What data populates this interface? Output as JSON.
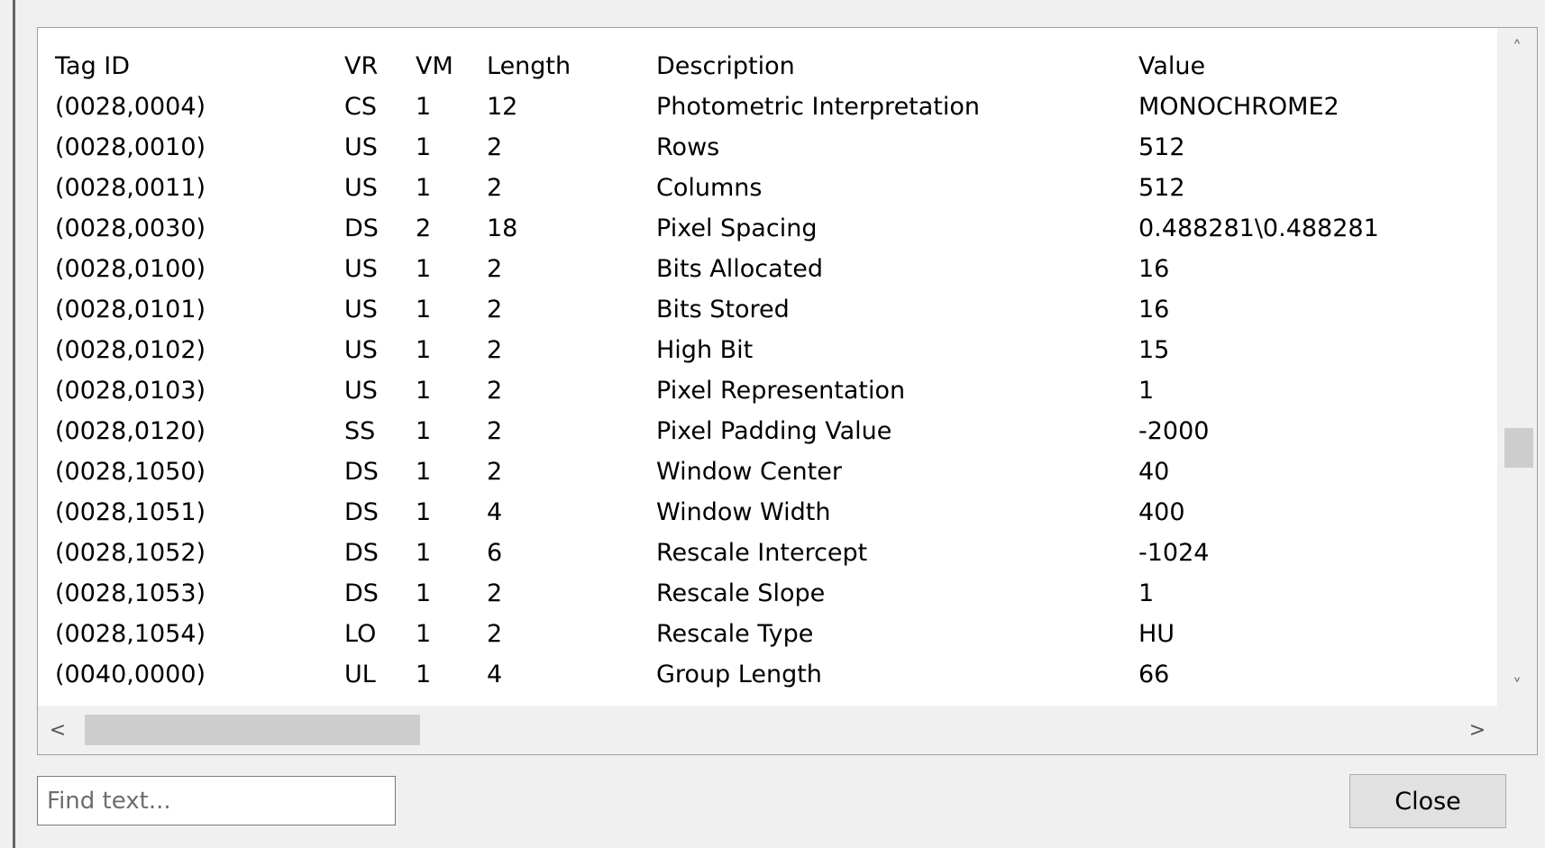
{
  "table": {
    "columns": [
      "Tag ID",
      "VR",
      "VM",
      "Length",
      "Description",
      "Value"
    ],
    "rows": [
      [
        "(0028,0004)",
        "CS",
        "1",
        "12",
        "Photometric Interpretation",
        "MONOCHROME2"
      ],
      [
        "(0028,0010)",
        "US",
        "1",
        "2",
        "Rows",
        "512"
      ],
      [
        "(0028,0011)",
        "US",
        "1",
        "2",
        "Columns",
        "512"
      ],
      [
        "(0028,0030)",
        "DS",
        "2",
        "18",
        "Pixel Spacing",
        "0.488281\\0.488281"
      ],
      [
        "(0028,0100)",
        "US",
        "1",
        "2",
        "Bits Allocated",
        "16"
      ],
      [
        "(0028,0101)",
        "US",
        "1",
        "2",
        "Bits Stored",
        "16"
      ],
      [
        "(0028,0102)",
        "US",
        "1",
        "2",
        "High Bit",
        "15"
      ],
      [
        "(0028,0103)",
        "US",
        "1",
        "2",
        "Pixel Representation",
        "1"
      ],
      [
        "(0028,0120)",
        "SS",
        "1",
        "2",
        "Pixel Padding Value",
        "-2000"
      ],
      [
        "(0028,1050)",
        "DS",
        "1",
        "2",
        "Window Center",
        "40"
      ],
      [
        "(0028,1051)",
        "DS",
        "1",
        "4",
        "Window Width",
        "400"
      ],
      [
        "(0028,1052)",
        "DS",
        "1",
        "6",
        "Rescale Intercept",
        "-1024"
      ],
      [
        "(0028,1053)",
        "DS",
        "1",
        "2",
        "Rescale Slope",
        "1"
      ],
      [
        "(0028,1054)",
        "LO",
        "1",
        "2",
        "Rescale Type",
        "HU"
      ],
      [
        "(0040,0000)",
        "UL",
        "1",
        "4",
        "Group Length",
        "66"
      ]
    ]
  },
  "scrollbars": {
    "up_arrow": "˄",
    "down_arrow": "˅",
    "left_arrow": "<",
    "right_arrow": ">"
  },
  "search": {
    "placeholder": "Find text..."
  },
  "footer": {
    "close_label": "Close"
  }
}
